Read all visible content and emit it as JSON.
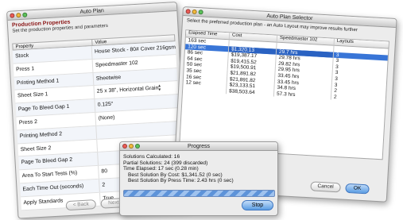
{
  "auto_plan": {
    "title": "Auto Plan",
    "header": {
      "heading": "Production Properties",
      "subheading": "Set the production properties and parameters"
    },
    "columns": [
      "Property",
      "Value"
    ],
    "properties": [
      {
        "name": "Stock",
        "value": "House Stock - 80# Cover 216gsm"
      },
      {
        "name": "Press 1",
        "value": "Speedmaster 102"
      },
      {
        "name": "Printing Method 1",
        "value": "Sheetwise"
      },
      {
        "name": "Sheet Size 1",
        "value": "25 x 38\", Horizontal Grain"
      },
      {
        "name": "Page To Bleed Gap 1",
        "value": "0.125\""
      },
      {
        "name": "Press 2",
        "value": "(None)"
      },
      {
        "name": "Printing Method 2",
        "value": ""
      },
      {
        "name": "Sheet Size 2",
        "value": ""
      },
      {
        "name": "Page To Bleed Gap 2",
        "value": ""
      },
      {
        "name": "Area To Start Tests (%)",
        "value": "80"
      },
      {
        "name": "Each Time Out (seconds)",
        "value": "2"
      },
      {
        "name": "Apply Standards",
        "value": "True"
      }
    ],
    "buttons": {
      "back": "< Back",
      "next": "Next >"
    }
  },
  "selector": {
    "title": "Auto Plan Selector",
    "instruction": "Select the preferred production plan - an Auto Layout may improve results further",
    "columns": [
      "Elapsed Time",
      "Cost",
      "Speedmaster 102",
      "Layouts"
    ],
    "rows": [
      {
        "time": "163 sec",
        "cost": "",
        "press": "",
        "layouts": ""
      },
      {
        "time": "120 sec",
        "cost": "$1,320.13",
        "press": "29.7 hrs",
        "layouts": "3"
      },
      {
        "time": "86 sec",
        "cost": "$19,387.17",
        "press": "29.78 hrs",
        "layouts": "3"
      },
      {
        "time": "64 sec",
        "cost": "$19,415.52",
        "press": "29.82 hrs",
        "layouts": "3"
      },
      {
        "time": "50 sec",
        "cost": "$19,500.91",
        "press": "29.95 hrs",
        "layouts": "3"
      },
      {
        "time": "35 sec",
        "cost": "$21,891.82",
        "press": "33.45 hrs",
        "layouts": "3"
      },
      {
        "time": "16 sec",
        "cost": "$21,891.82",
        "press": "33.45 hrs",
        "layouts": "3"
      },
      {
        "time": "12 sec",
        "cost": "$23,133.51",
        "press": "34.8 hrs",
        "layouts": "2"
      },
      {
        "time": "",
        "cost": "$38,503.64",
        "press": "57.3 hrs",
        "layouts": "2"
      }
    ],
    "selected_row": 1,
    "buttons": {
      "cancel": "Cancel",
      "ok": "OK"
    }
  },
  "progress": {
    "title": "Progress",
    "lines": {
      "calculated": "Solutions Calculated: 16",
      "partial": "Partial Solutions: 24 (399 discarded)",
      "elapsed": "Time Elapsed: 17 sec (0.28 min)",
      "best_cost": "Best Solution By Cost: $1,341.52 (0 sec)",
      "best_press": "Best Solution By Press Time: 2.43 hrs (0 sec)"
    },
    "stop_label": "Stop"
  },
  "colors": {
    "close": "#ec5b55",
    "minimize": "#f2b93b",
    "zoom": "#5cc25a",
    "selection": "#3875d7",
    "heading": "#8a1414"
  }
}
